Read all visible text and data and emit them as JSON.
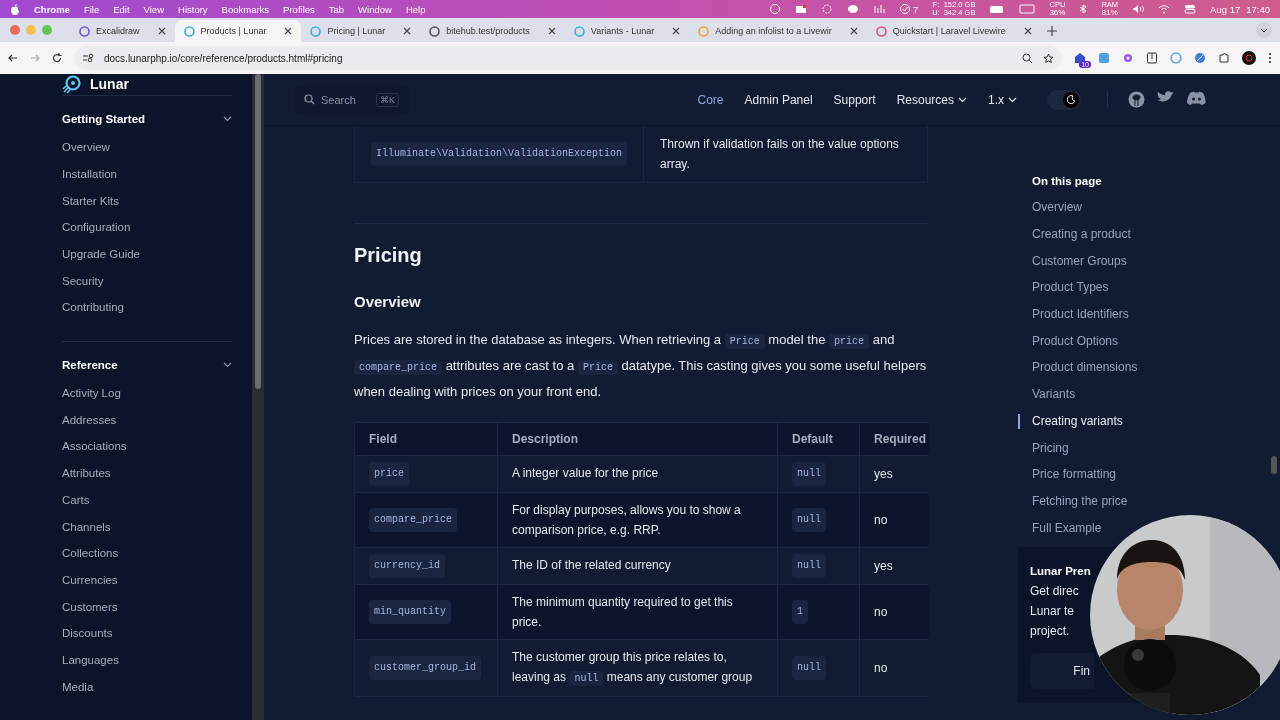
{
  "menu_bar": {
    "app": "Chrome",
    "menus": [
      "File",
      "Edit",
      "View",
      "History",
      "Bookmarks",
      "Profiles",
      "Tab",
      "Window",
      "Help"
    ],
    "status": {
      "tasks": "7",
      "disk_labels": [
        "F:",
        "U:"
      ],
      "disk_values": [
        "152.0 GB",
        "342.4 GB"
      ],
      "cpu_label": "CPU",
      "cpu": "36%",
      "ram_label": "RAM",
      "ram": "81%",
      "date": "Aug 17",
      "time": "17:40"
    }
  },
  "tabs": [
    {
      "title": "Excalidraw",
      "selected": false
    },
    {
      "title": "Products | Lunar",
      "selected": true
    },
    {
      "title": "Pricing | Lunar",
      "selected": false
    },
    {
      "title": "bitehub.test/products",
      "selected": false
    },
    {
      "title": "Variants - Lunar",
      "selected": false
    },
    {
      "title": "Adding an infolist to a Livewir",
      "selected": false
    },
    {
      "title": "Quickstart | Laravel Livewire",
      "selected": false
    }
  ],
  "address_bar": {
    "url": "docs.lunarphp.io/core/reference/products.html#pricing",
    "extension_badge": "10"
  },
  "site_header": {
    "logo": "Lunar",
    "search": {
      "placeholder": "Search",
      "shortcut": "⌘K"
    },
    "nav": [
      {
        "label": "Core",
        "selected": true,
        "dropdown": false
      },
      {
        "label": "Admin Panel",
        "selected": false,
        "dropdown": false
      },
      {
        "label": "Support",
        "selected": false,
        "dropdown": false
      },
      {
        "label": "Resources",
        "selected": false,
        "dropdown": true
      },
      {
        "label": "1.x",
        "selected": false,
        "dropdown": true
      }
    ],
    "dark_mode": true
  },
  "sidebar": {
    "groups": [
      {
        "title": "Getting Started",
        "expanded": true,
        "items": [
          "Overview",
          "Installation",
          "Starter Kits",
          "Configuration",
          "Upgrade Guide",
          "Security",
          "Contributing"
        ]
      },
      {
        "title": "Reference",
        "expanded": true,
        "items": [
          "Activity Log",
          "Addresses",
          "Associations",
          "Attributes",
          "Carts",
          "Channels",
          "Collections",
          "Currencies",
          "Customers",
          "Discounts",
          "Languages",
          "Media"
        ]
      }
    ]
  },
  "content": {
    "previous_table_row": {
      "code": "Illuminate\\Validation\\ValidationException",
      "description": "Thrown if validation fails on the value options array."
    },
    "heading": "Pricing",
    "subheading": "Overview",
    "paragraph": [
      {
        "kind": "text",
        "text": "Prices are stored in the database as integers. When retrieving a "
      },
      {
        "kind": "code",
        "text": "Price"
      },
      {
        "kind": "text",
        "text": " model the "
      },
      {
        "kind": "code",
        "text": "price"
      },
      {
        "kind": "text",
        "text": " and "
      },
      {
        "kind": "code",
        "text": "compare_price"
      },
      {
        "kind": "text",
        "text": " attributes are cast to a "
      },
      {
        "kind": "code",
        "text": "Price"
      },
      {
        "kind": "text",
        "text": " datatype. This casting gives you some useful helpers when dealing with prices on your front end."
      }
    ],
    "table": {
      "columns": [
        "Field",
        "Description",
        "Default",
        "Required"
      ],
      "rows": [
        {
          "field": "price",
          "description": [
            {
              "kind": "text",
              "text": "A integer value for the price"
            }
          ],
          "default": "null",
          "required": "yes"
        },
        {
          "field": "compare_price",
          "description": [
            {
              "kind": "text",
              "text": "For display purposes, allows you to show a comparison price, e.g. RRP."
            }
          ],
          "default": "null",
          "required": "no"
        },
        {
          "field": "currency_id",
          "description": [
            {
              "kind": "text",
              "text": "The ID of the related currency"
            }
          ],
          "default": "null",
          "required": "yes"
        },
        {
          "field": "min_quantity",
          "description": [
            {
              "kind": "text",
              "text": "The minimum quantity required to get this price."
            }
          ],
          "default": "1",
          "required": "no"
        },
        {
          "field": "customer_group_id",
          "description": [
            {
              "kind": "text",
              "text": "The customer group this price relates to, leaving as "
            },
            {
              "kind": "code",
              "text": "null"
            },
            {
              "kind": "text",
              "text": " means any customer group"
            }
          ],
          "default": "null",
          "required": "no"
        }
      ]
    }
  },
  "toc": {
    "title": "On this page",
    "items": [
      {
        "label": "Overview",
        "selected": false
      },
      {
        "label": "Creating a product",
        "selected": false
      },
      {
        "label": "Customer Groups",
        "selected": false
      },
      {
        "label": "Product Types",
        "selected": false
      },
      {
        "label": "Product Identifiers",
        "selected": false
      },
      {
        "label": "Product Options",
        "selected": false
      },
      {
        "label": "Product dimensions",
        "selected": false
      },
      {
        "label": "Variants",
        "selected": false
      },
      {
        "label": "Creating variants",
        "selected": true
      },
      {
        "label": "Pricing",
        "selected": false
      },
      {
        "label": "Price formatting",
        "selected": false
      },
      {
        "label": "Fetching the price",
        "selected": false
      },
      {
        "label": "Full Example",
        "selected": false
      }
    ],
    "promo": {
      "title": "Lunar Pren",
      "lines": [
        "Get direc",
        "Lunar te",
        "project."
      ],
      "button": "Fin"
    }
  }
}
